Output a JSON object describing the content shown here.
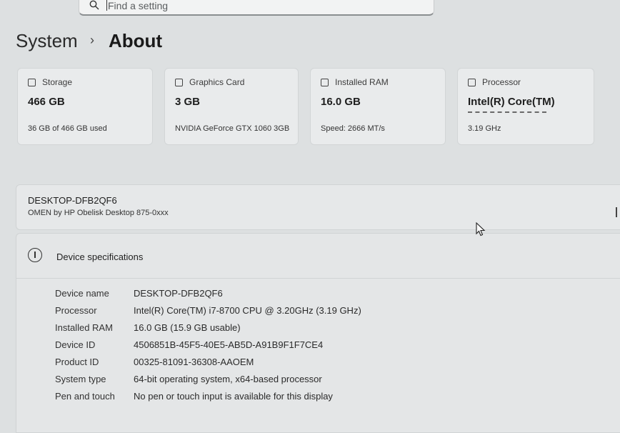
{
  "search": {
    "placeholder": "Find a setting"
  },
  "breadcrumb": {
    "parent": "System",
    "separator": "›",
    "current": "About"
  },
  "cards": [
    {
      "title": "Storage",
      "value": "466 GB",
      "sub": "36 GB of 466 GB used",
      "icon": "storage-icon"
    },
    {
      "title": "Graphics Card",
      "value": "3 GB",
      "sub": "NVIDIA GeForce GTX 1060 3GB",
      "icon": "graphics-card-icon"
    },
    {
      "title": "Installed RAM",
      "value": "16.0 GB",
      "sub": "Speed: 2666 MT/s",
      "icon": "ram-icon"
    },
    {
      "title": "Processor",
      "value": "Intel(R) Core(TM)",
      "sub": "3.19 GHz",
      "icon": "processor-icon"
    }
  ],
  "device": {
    "name": "DESKTOP-DFB2QF6",
    "model": "OMEN by HP Obelisk Desktop 875-0xxx"
  },
  "specs": {
    "header": "Device specifications",
    "rows": [
      {
        "label": "Device name",
        "value": "DESKTOP-DFB2QF6"
      },
      {
        "label": "Processor",
        "value": "Intel(R) Core(TM) i7-8700 CPU @ 3.20GHz (3.19 GHz)"
      },
      {
        "label": "Installed RAM",
        "value": "16.0 GB (15.9 GB usable)"
      },
      {
        "label": "Device ID",
        "value": "4506851B-45F5-40E5-AB5D-A91B9F1F7CE4"
      },
      {
        "label": "Product ID",
        "value": "00325-81091-36308-AAOEM"
      },
      {
        "label": "System type",
        "value": "64-bit operating system, x64-based processor"
      },
      {
        "label": "Pen and touch",
        "value": "No pen or touch input is available for this display"
      }
    ]
  }
}
